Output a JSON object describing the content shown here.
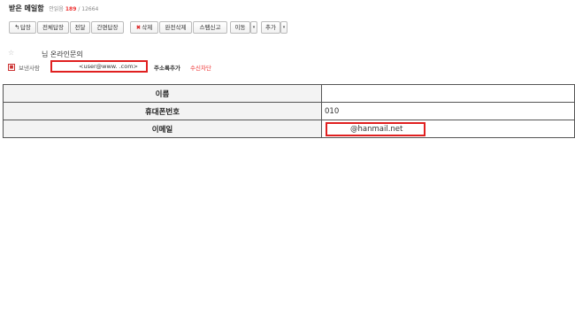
{
  "header": {
    "title": "받은 메일함",
    "unread_label": "안읽음",
    "unread_count": "189",
    "separator": "/",
    "total_count": "12664"
  },
  "toolbar": {
    "reply": "답장",
    "reply_all": "전체답장",
    "forward": "전달",
    "quick_reply": "간편답장",
    "delete": "삭제",
    "perm_delete": "완전삭제",
    "spam": "스팸신고",
    "move": "이동",
    "more": "추가"
  },
  "mail": {
    "subject": "님 온라인문의",
    "sender_label": "보낸사람",
    "sender_address": "<user@www.          .com>",
    "add_contact": "주소록추가",
    "block": "수신차단"
  },
  "form": {
    "rows": [
      {
        "label": "이름",
        "value": ""
      },
      {
        "label": "휴대폰번호",
        "value": "010"
      },
      {
        "label": "이메일",
        "value": "@hanmail.net"
      }
    ]
  },
  "colors": {
    "highlight_box": "#e02020",
    "unread": "#e33333"
  },
  "icons": {
    "reply": "reply-arrow-icon",
    "delete": "x-icon",
    "star": "star-outline-icon"
  }
}
